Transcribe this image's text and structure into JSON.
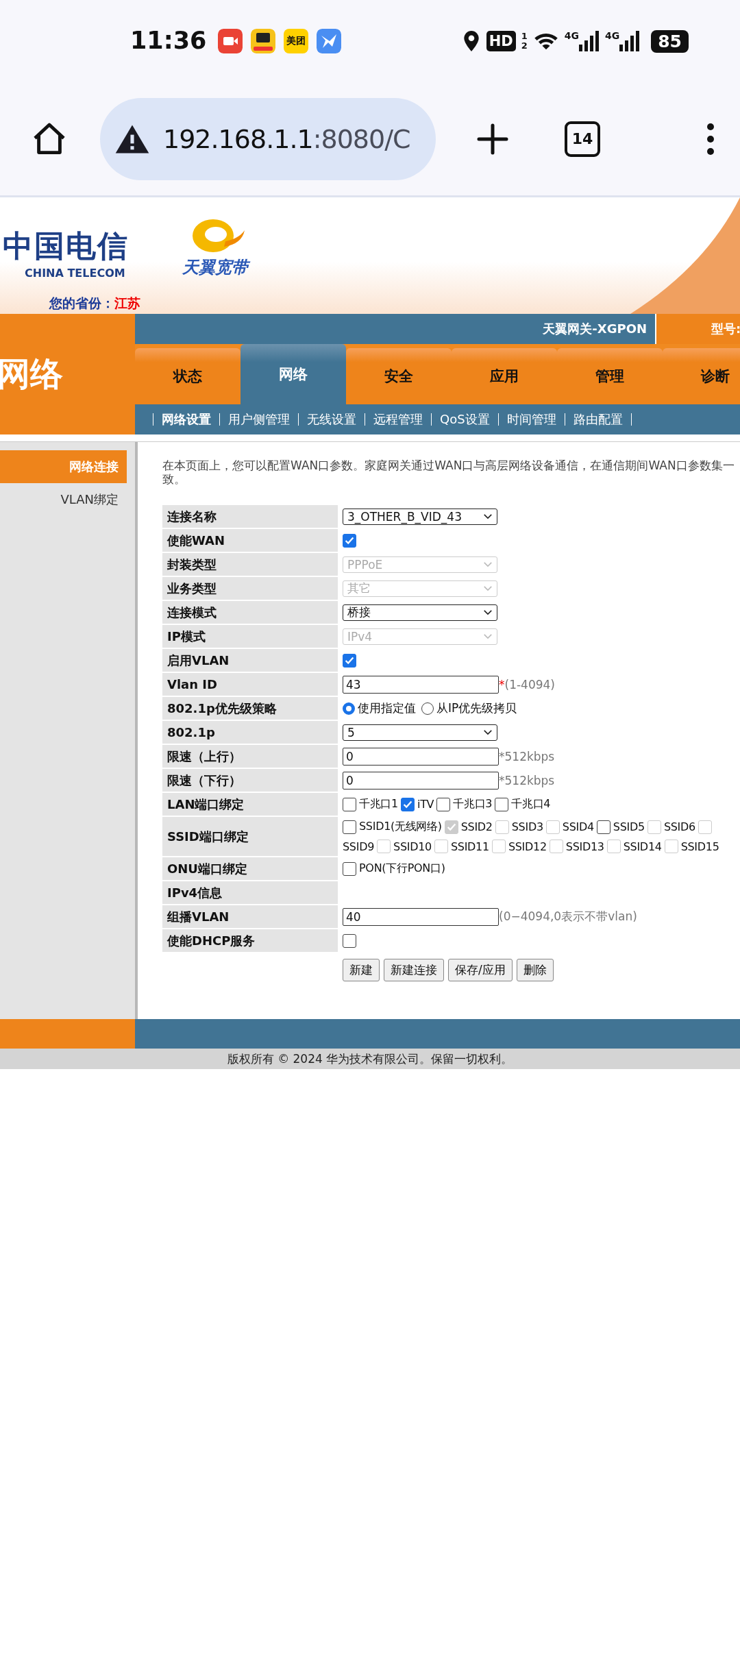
{
  "status_bar": {
    "time": "11:36",
    "apps": [
      {
        "kind": "video",
        "color": "#ea4335"
      },
      {
        "kind": "fish",
        "color": "#f6c21a"
      },
      {
        "kind": "text",
        "label": "美团",
        "color": "#ffd100"
      },
      {
        "kind": "bird",
        "color": "#4a8ef2"
      }
    ],
    "hd": "HD",
    "hd_sub": [
      "1",
      "2"
    ],
    "networks": [
      "4G",
      "4G"
    ],
    "battery": "85"
  },
  "browser": {
    "url_host": "192.168.1.1",
    "url_rest": ":8080/C",
    "tab_count": "14"
  },
  "header": {
    "brand_cn": "中国电信",
    "brand_en": "CHINA TELECOM",
    "product": "天翼宽带",
    "province_label": "您的省份：",
    "province": "江苏",
    "gateway": "天翼网关-XGPON",
    "model_label": "型号:"
  },
  "section_title": "网络",
  "tabs": [
    {
      "label": "状态",
      "selected": false
    },
    {
      "label": "网络",
      "selected": true
    },
    {
      "label": "安全",
      "selected": false
    },
    {
      "label": "应用",
      "selected": false
    },
    {
      "label": "管理",
      "selected": false
    },
    {
      "label": "诊断",
      "selected": false
    }
  ],
  "subtabs": [
    {
      "label": "网络设置",
      "selected": true
    },
    {
      "label": "用户侧管理",
      "selected": false
    },
    {
      "label": "无线设置",
      "selected": false
    },
    {
      "label": "远程管理",
      "selected": false
    },
    {
      "label": "QoS设置",
      "selected": false
    },
    {
      "label": "时间管理",
      "selected": false
    },
    {
      "label": "路由配置",
      "selected": false
    }
  ],
  "sidebar": [
    {
      "label": "网络连接",
      "selected": true
    },
    {
      "label": "VLAN绑定",
      "selected": false
    }
  ],
  "intro": "在本页面上，您可以配置WAN口参数。家庭网关通过WAN口与高层网络设备通信，在通信期间WAN口参数集一致。",
  "form": [
    {
      "kind": "select",
      "label": "连接名称",
      "value": "3_OTHER_B_VID_43",
      "disabled": false
    },
    {
      "kind": "checkbox",
      "label": "使能WAN",
      "checked": true
    },
    {
      "kind": "select",
      "label": "封装类型",
      "value": "PPPoE",
      "disabled": true
    },
    {
      "kind": "select",
      "label": "业务类型",
      "value": "其它",
      "disabled": true
    },
    {
      "kind": "select",
      "label": "连接模式",
      "value": "桥接",
      "disabled": false
    },
    {
      "kind": "select",
      "label": "IP模式",
      "value": "IPv4",
      "disabled": true
    },
    {
      "kind": "checkbox",
      "label": "启用VLAN",
      "checked": true
    },
    {
      "kind": "text",
      "label": "Vlan ID",
      "value": "43",
      "mark": "*",
      "hint": "(1-4094)"
    },
    {
      "kind": "radio",
      "label": "802.1p优先级策略",
      "options": [
        {
          "label": "使用指定值",
          "selected": true
        },
        {
          "label": "从IP优先级拷贝",
          "selected": false
        }
      ]
    },
    {
      "kind": "select",
      "label": "802.1p",
      "value": "5",
      "disabled": false
    },
    {
      "kind": "text",
      "label": "限速（上行）",
      "value": "0",
      "hint": "*512kbps"
    },
    {
      "kind": "text",
      "label": "限速（下行）",
      "value": "0",
      "hint": "*512kbps"
    },
    {
      "kind": "checks",
      "label": "LAN端口绑定",
      "lines": [
        [
          {
            "kind": "box",
            "label": "千兆口1",
            "checked": false,
            "disabled": false
          },
          {
            "kind": "box",
            "label": "iTV",
            "checked": true,
            "disabled": false
          },
          {
            "kind": "box",
            "label": "千兆口3",
            "checked": false,
            "disabled": false
          },
          {
            "kind": "box",
            "label": "千兆口4",
            "checked": false,
            "disabled": false
          }
        ]
      ]
    },
    {
      "kind": "checks",
      "label": "SSID端口绑定",
      "lines": [
        [
          {
            "kind": "box",
            "label": "SSID1(无线网络)",
            "checked": false,
            "disabled": false
          },
          {
            "kind": "box",
            "label": "SSID2",
            "checked": true,
            "disabled": true
          },
          {
            "kind": "box",
            "label": "SSID3",
            "checked": false,
            "disabled": true
          },
          {
            "kind": "box",
            "label": "SSID4",
            "checked": false,
            "disabled": true
          },
          {
            "kind": "box",
            "label": "SSID5",
            "checked": false,
            "disabled": false
          },
          {
            "kind": "box",
            "label": "SSID6",
            "checked": false,
            "disabled": true
          },
          {
            "kind": "box_only",
            "checked": false,
            "disabled": true
          }
        ],
        [
          {
            "kind": "text",
            "label": "SSID9"
          },
          {
            "kind": "box",
            "label": "SSID10",
            "checked": false,
            "disabled": true
          },
          {
            "kind": "box",
            "label": "SSID11",
            "checked": false,
            "disabled": true
          },
          {
            "kind": "box",
            "label": "SSID12",
            "checked": false,
            "disabled": true
          },
          {
            "kind": "box",
            "label": "SSID13",
            "checked": false,
            "disabled": true
          },
          {
            "kind": "box",
            "label": "SSID14",
            "checked": false,
            "disabled": true
          },
          {
            "kind": "box",
            "label": "SSID15",
            "checked": false,
            "disabled": true
          }
        ]
      ]
    },
    {
      "kind": "checks",
      "label": "ONU端口绑定",
      "lines": [
        [
          {
            "kind": "box",
            "label": "PON(下行PON口)",
            "checked": false,
            "disabled": false
          }
        ]
      ]
    },
    {
      "kind": "empty",
      "label": "IPv4信息"
    },
    {
      "kind": "text",
      "label": "组播VLAN",
      "value": "40",
      "hint": "(0−4094,0表示不带vlan)"
    },
    {
      "kind": "checkbox",
      "label": "使能DHCP服务",
      "checked": false
    }
  ],
  "buttons": [
    "新建",
    "新建连接",
    "保存/应用",
    "删除"
  ],
  "footer": "版权所有 © 2024 华为技术有限公司。保留一切权利。"
}
